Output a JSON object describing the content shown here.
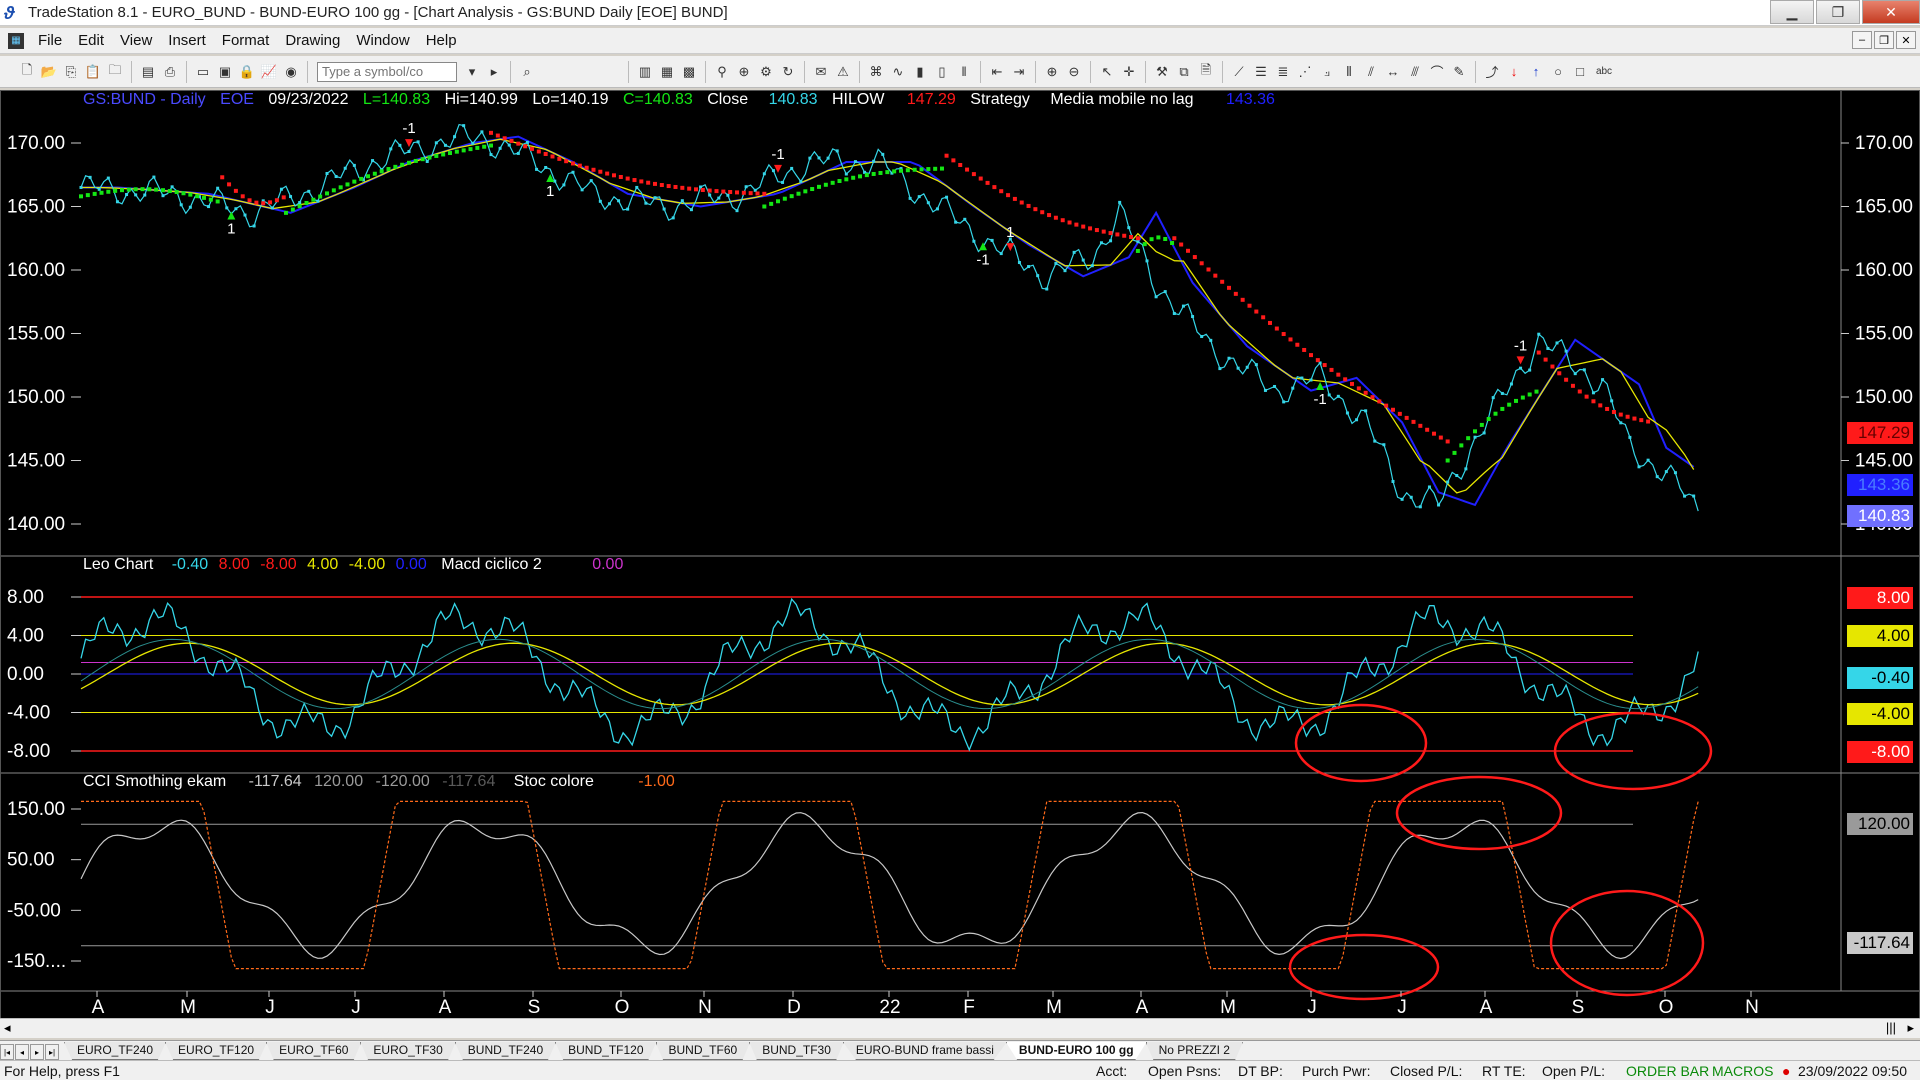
{
  "window": {
    "title": "TradeStation 8.1 - EURO_BUND - BUND-EURO 100 gg - [Chart Analysis - GS:BUND  Daily  [EOE] BUND]",
    "minimize": "▁",
    "maximize": "❐",
    "close": "✕"
  },
  "menu": [
    "File",
    "Edit",
    "View",
    "Insert",
    "Format",
    "Drawing",
    "Window",
    "Help"
  ],
  "toolbar": {
    "symbol_placeholder": "Type a symbol/co"
  },
  "price_pane": {
    "header": {
      "symbol": "GS:BUND - Daily",
      "exchange": "EOE",
      "date": "09/23/2022",
      "low": "L=140.83",
      "high": "Hi=140.99",
      "lo": "Lo=140.19",
      "close_label": "C=140.83",
      "close_text": "Close",
      "close_value": "140.83",
      "hilow_text": "HILOW",
      "hilow_value": "147.29",
      "strategy_text": "Strategy",
      "ma_text": "Media mobile no lag",
      "ma_value": "143.36"
    },
    "yticks": [
      "170.00",
      "165.00",
      "160.00",
      "155.00",
      "150.00",
      "145.00",
      "140.00"
    ],
    "price_tags": {
      "hilow": "147.29",
      "ma": "143.36",
      "close": "140.83"
    },
    "signals": [
      "1",
      "-1",
      "1",
      "-1",
      "-1",
      "1",
      "-1",
      "-1"
    ]
  },
  "osc_pane": {
    "header": {
      "name": "Leo Chart",
      "v1": "-0.40",
      "v2": "8.00",
      "v3": "-8.00",
      "v4": "4.00",
      "v5": "-4.00",
      "v6": "0.00",
      "name2": "Macd ciclico 2",
      "v7": "0.00"
    },
    "yticks": [
      "8.00",
      "4.00",
      "0.00",
      "-4.00",
      "-8.00"
    ],
    "tags": {
      "t1": "8.00",
      "t2": "4.00",
      "t3": "-0.40",
      "t4": "-4.00",
      "t5": "-8.00"
    }
  },
  "cci_pane": {
    "header": {
      "name": "CCI Smothing ekam",
      "v1": "-117.64",
      "v2": "120.00",
      "v3": "-120.00",
      "v4": "-117.64",
      "name2": "Stoc colore",
      "v5": "-1.00"
    },
    "yticks": [
      "150.00",
      "50.00",
      "-50.00",
      "-150...."
    ],
    "tags": {
      "t1": "150.00",
      "t2": "120.00",
      "t3": "50.00",
      "t4": "-50.00",
      "t5": "-117.64",
      "t6": "-150.00"
    }
  },
  "xaxis": [
    "A",
    "M",
    "J",
    "J",
    "A",
    "S",
    "O",
    "N",
    "D",
    "22",
    "F",
    "M",
    "A",
    "M",
    "J",
    "J",
    "A",
    "S",
    "O",
    "N"
  ],
  "tabs": [
    "EURO_TF240",
    "EURO_TF120",
    "EURO_TF60",
    "EURO_TF30",
    "BUND_TF240",
    "BUND_TF120",
    "BUND_TF60",
    "BUND_TF30",
    "EURO-BUND frame bassi",
    "BUND-EURO 100 gg",
    "No PREZZI 2"
  ],
  "active_tab": "BUND-EURO 100 gg",
  "status": {
    "help": "For Help, press F1",
    "acct": "Acct:",
    "open_psns": "Open Psns:",
    "dt_bp": "DT BP:",
    "purch_pwr": "Purch Pwr:",
    "closed_pl": "Closed P/L:",
    "rt_te": "RT TE:",
    "open_pl": "Open P/L:",
    "order_bar": "ORDER BAR",
    "macros": "MACROS",
    "datetime": "23/09/2022 09:50"
  },
  "colors": {
    "cyan": "#35d6e8",
    "red": "#ff1a1a",
    "green": "#14e614",
    "yellow": "#e6e600",
    "blue": "#2020ff",
    "purple": "#cc33cc",
    "orange": "#ff6a1a",
    "grey": "#c8c8c8"
  }
}
